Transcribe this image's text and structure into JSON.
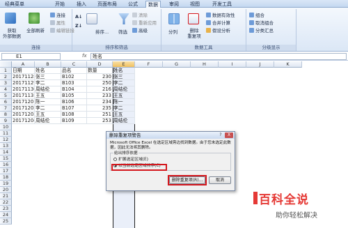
{
  "ribbon": {
    "tabs": [
      "经典菜单",
      "开始",
      "插入",
      "页面布局",
      "公式",
      "数据",
      "审阅",
      "视图",
      "开发工具"
    ],
    "active_tab": "数据",
    "groups": {
      "connections": {
        "label": "连接",
        "get_external": "获取\n外部数据",
        "refresh_all": "全部刷新",
        "connections": "连接",
        "properties": "属性",
        "edit_links": "编辑链接"
      },
      "sort_filter": {
        "label": "排序和筛选",
        "sort": "排序...",
        "filter": "筛选",
        "clear": "清除",
        "reapply": "重新应用",
        "advanced": "高级"
      },
      "data_tools": {
        "label": "数据工具",
        "text_to_columns": "分列",
        "remove_dup": "删除\n重复项",
        "validation": "数据有效性",
        "consolidate": "合并计算",
        "what_if": "假设分析"
      },
      "outline": {
        "label": "分级显示",
        "group": "组合",
        "ungroup": "取消组合",
        "subtotal": "分类汇总"
      }
    }
  },
  "formula_bar": {
    "name_box": "E1",
    "fx": "fx",
    "value": "姓名"
  },
  "columns": [
    "A",
    "B",
    "C",
    "D",
    "E",
    "F",
    "G",
    "H",
    "I",
    "J",
    "K"
  ],
  "selected_column": "E",
  "rows": [
    [
      "日期",
      "姓名",
      "品名",
      "数量",
      "姓名"
    ],
    [
      "20171128",
      "张三",
      "B102",
      "230",
      "张三"
    ],
    [
      "20171129",
      "李二",
      "B103",
      "250",
      "李二"
    ],
    [
      "20171130",
      "周结伦",
      "B104",
      "216",
      "周结伦"
    ],
    [
      "20171131",
      "王五",
      "B105",
      "233",
      "王五"
    ],
    [
      "20171201",
      "陈一",
      "B106",
      "234",
      "陈一"
    ],
    [
      "20171202",
      "李二",
      "B107",
      "235",
      "李二"
    ],
    [
      "20171203",
      "王五",
      "B108",
      "251",
      "王五"
    ],
    [
      "20171204",
      "周结伦",
      "B109",
      "253",
      "周结伦"
    ]
  ],
  "row_numbers": [
    "1",
    "2",
    "3",
    "4",
    "5",
    "6",
    "7",
    "8",
    "9",
    "10",
    "11",
    "12",
    "13",
    "14",
    "15",
    "16",
    "17",
    "18",
    "19",
    "20",
    "21",
    "22",
    "23",
    "24",
    "25"
  ],
  "dialog": {
    "title": "删除重复项警告",
    "message": "Microsoft Office Excel 在选定区域旁边找到数据。由于您未选定此数据，因此无法将其删除。",
    "group_label": "给出排序依据",
    "option1": "扩展选定区域(E)",
    "option2": "以当前选定区域排序(C)",
    "selected_option": 2,
    "ok_button": "删除重复项(R)...",
    "cancel_button": "取消",
    "help": "?",
    "close": "X"
  },
  "watermark": {
    "title": "百科全说",
    "subtitle": "助你轻松解决"
  },
  "colors": {
    "accent_red": "#d4161c",
    "ribbon_blue": "#dbe7f6",
    "brand_red": "#e53935"
  }
}
